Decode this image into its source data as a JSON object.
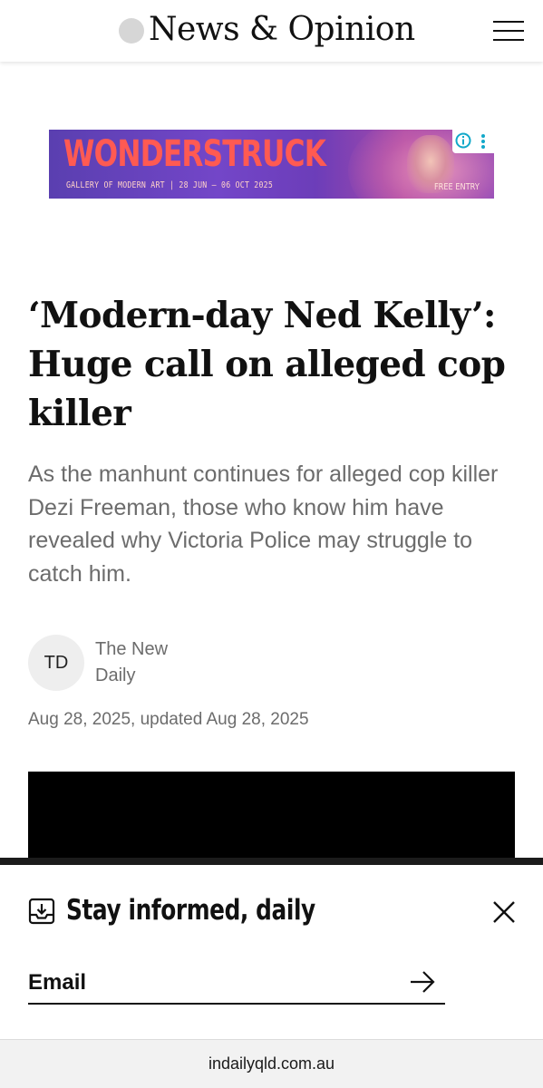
{
  "header": {
    "site_title": "News & Opinion"
  },
  "ad": {
    "title": "WONDERSTRUCK",
    "subtitle": "GALLERY OF MODERN ART | 28 JUN — 06 OCT 2025",
    "badge": "FREE ENTRY"
  },
  "article": {
    "headline": "‘Modern-day Ned Kelly’: Huge call on alleged cop killer",
    "standfirst": "As the manhunt continues for alleged cop killer Dezi Freeman, those who know him have revealed why Victoria Police may struggle to catch him.",
    "byline": {
      "initials": "TD",
      "author": "The New Daily"
    },
    "date": "Aug 28, 2025, updated Aug 28, 2025"
  },
  "newsletter": {
    "title": "Stay informed, daily",
    "email_placeholder": "Email"
  },
  "browser": {
    "url": "indailyqld.com.au"
  },
  "colors": {
    "ad_title": "#ff5a52",
    "muted_text": "#6c6c6c",
    "ad_background": "#6c3db9"
  }
}
